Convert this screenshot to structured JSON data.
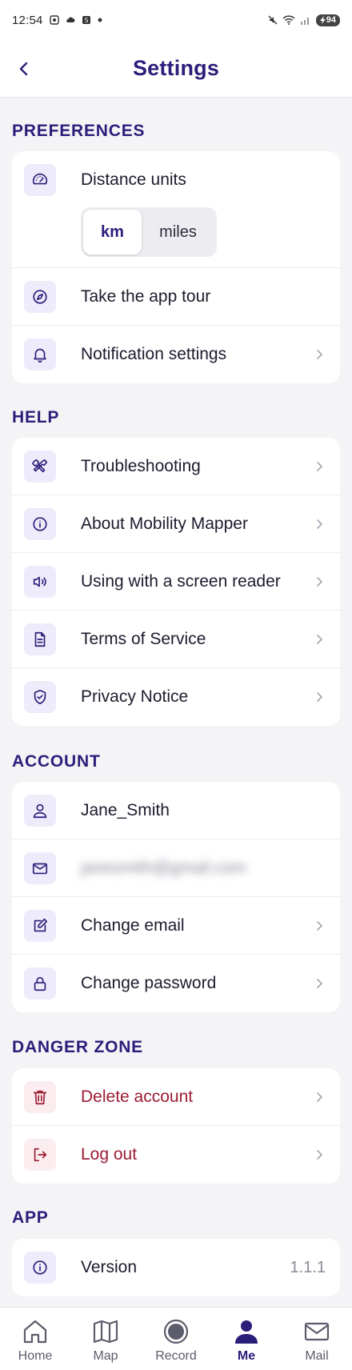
{
  "status_bar": {
    "time": "12:54",
    "battery": "94"
  },
  "header": {
    "title": "Settings"
  },
  "sections": {
    "preferences": {
      "title": "PREFERENCES",
      "distance_units": {
        "label": "Distance units",
        "options": [
          "km",
          "miles"
        ],
        "selected": "km"
      },
      "app_tour": "Take the app tour",
      "notification_settings": "Notification settings"
    },
    "help": {
      "title": "HELP",
      "troubleshooting": "Troubleshooting",
      "about": "About Mobility Mapper",
      "screen_reader": "Using with a screen reader",
      "terms": "Terms of Service",
      "privacy": "Privacy Notice"
    },
    "account": {
      "title": "ACCOUNT",
      "username": "Jane_Smith",
      "email": "janesmith@gmail.com",
      "change_email": "Change email",
      "change_password": "Change password"
    },
    "danger": {
      "title": "DANGER ZONE",
      "delete_account": "Delete account",
      "log_out": "Log out"
    },
    "app": {
      "title": "APP",
      "version_label": "Version",
      "version_value": "1.1.1"
    }
  },
  "tab_bar": {
    "items": [
      {
        "label": "Home",
        "icon": "home-icon"
      },
      {
        "label": "Map",
        "icon": "map-icon"
      },
      {
        "label": "Record",
        "icon": "record-icon"
      },
      {
        "label": "Me",
        "icon": "person-icon"
      },
      {
        "label": "Mail",
        "icon": "mail-icon"
      }
    ],
    "active": "Me"
  },
  "colors": {
    "brand": "#2a1e7a",
    "danger": "#9b1c32",
    "icon_bg": "#eeecfb",
    "danger_icon_bg": "#fbecef"
  }
}
